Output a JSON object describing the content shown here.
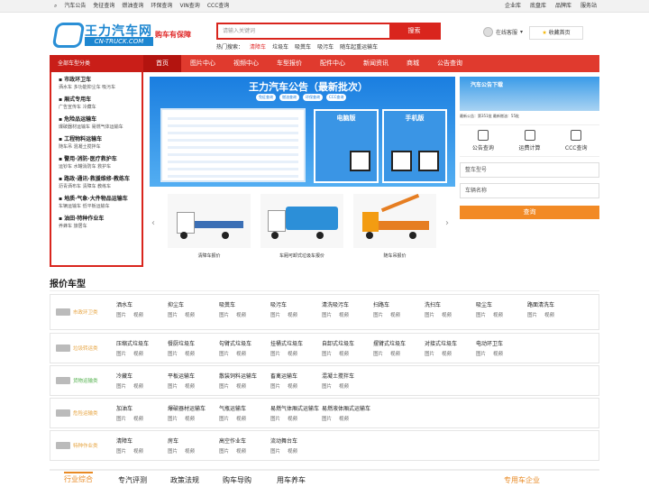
{
  "topbar": {
    "left": [
      "汽车公告",
      "免征查询",
      "燃油查询",
      "环保查询",
      "VIN查询",
      "CCC查询"
    ],
    "right": [
      "企业库",
      "底盘库",
      "品牌库",
      "服务站"
    ]
  },
  "logo": {
    "name": "王力汽车网",
    "domain": "CN-TRUCK.COM"
  },
  "slogan": "购车有保障",
  "search": {
    "placeholder": "请输入关键词",
    "button": "搜索"
  },
  "hot": {
    "label": "热门搜索：",
    "items": [
      "清障车",
      "垃圾车",
      "吸粪车",
      "吸污车",
      "随车起重运输车"
    ]
  },
  "service": {
    "label": "在线客服"
  },
  "favorite": {
    "label": "收藏首页"
  },
  "nav": {
    "category": "全部车型分类",
    "items": [
      "首页",
      "图片中心",
      "视频中心",
      "车型报价",
      "配件中心",
      "新闻资讯",
      "商城",
      "公告查询"
    ]
  },
  "sidebar": [
    {
      "title": "市政环卫车",
      "subs": "洒水车 多功能抑尘车 吸污车"
    },
    {
      "title": "厢式专用车",
      "subs": "广告宣传车 冷藏车"
    },
    {
      "title": "危险品运输车",
      "subs": "爆破器材运输车 易燃气体运输车"
    },
    {
      "title": "工程物料运输车",
      "subs": "随车吊 混凝土搅拌车"
    },
    {
      "title": "警用·消防·医疗救护车",
      "subs": "运钞车 水罐消防车 救护车"
    },
    {
      "title": "路政·通讯·救援维修·教练车",
      "subs": "沥青洒布车 清障车 教练车"
    },
    {
      "title": "地质·气象·大件物品运输车",
      "subs": "车辆运输车 低平板运输车"
    },
    {
      "title": "油田·特种作业车",
      "subs": "养蜂车 旅居车"
    }
  ],
  "banner": {
    "title": "王力汽车公告（最新批次）",
    "tags": [
      "免征查询",
      "燃油查询",
      "环保查询",
      "CCC查询"
    ],
    "pc_label": "电脑版",
    "mobile_label": "手机版"
  },
  "thumbs": [
    {
      "caption": "清障车报价"
    },
    {
      "caption": "车厢可卸式垃圾车报价"
    },
    {
      "caption": "随车吊报价"
    }
  ],
  "right_panel": {
    "ad_title": "汽车公告下载",
    "stats": "最新公告：第351批 最新燃油：55批",
    "tools": [
      "公告查询",
      "运费计算",
      "CCC查询"
    ],
    "fields": [
      "整车型号",
      "车辆名称"
    ],
    "query_button": "查询"
  },
  "quote_section": {
    "title": "报价车型",
    "rows": [
      {
        "label": "市政环卫类",
        "items": [
          "洒水车",
          "抑尘车",
          "吸粪车",
          "吸污车",
          "清洗吸污车",
          "扫路车",
          "洗扫车",
          "吸尘车",
          "路面清洗车"
        ]
      },
      {
        "label": "垃圾转运类",
        "items": [
          "压缩式垃圾车",
          "餐厨垃圾车",
          "勾臂式垃圾车",
          "挂桶式垃圾车",
          "自卸式垃圾车",
          "摆臂式垃圾车",
          "对接式垃圾车",
          "电动环卫车"
        ]
      },
      {
        "label": "货物运输类",
        "items": [
          "冷藏车",
          "平板运输车",
          "散装饲料运输车",
          "畜禽运输车",
          "混凝土搅拌车"
        ]
      },
      {
        "label": "危险运输类",
        "items": [
          "加油车",
          "爆破器材运输车",
          "气瓶运输车",
          "易燃气体厢式运输车",
          "易燃液体厢式运输车"
        ]
      },
      {
        "label": "特种作业类",
        "items": [
          "清障车",
          "房车",
          "高空作业车",
          "流动舞台车"
        ]
      }
    ],
    "sub_labels": [
      "图片",
      "视频"
    ]
  },
  "bottom_tabs": [
    "行业综合",
    "专汽评测",
    "政策法规",
    "购车导购",
    "用车养车"
  ],
  "bottom_right": "专用车企业"
}
